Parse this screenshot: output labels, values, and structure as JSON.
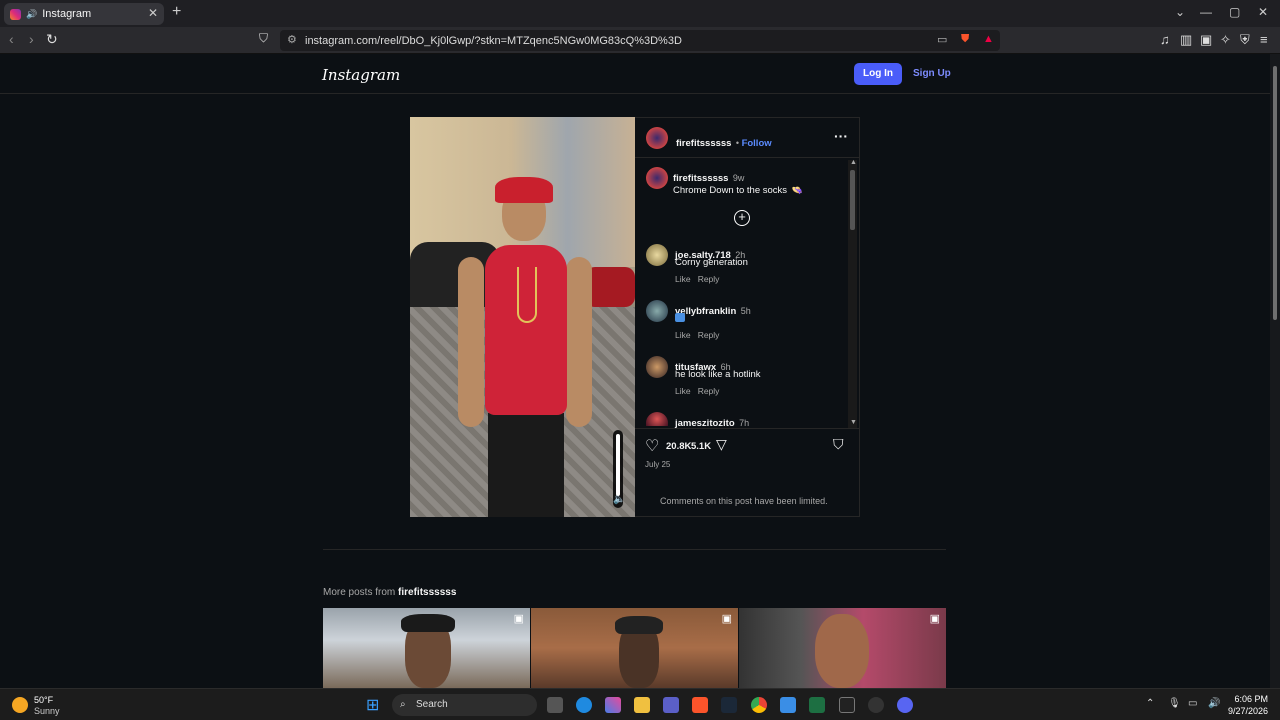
{
  "browser": {
    "tab_title": "Instagram",
    "url": "instagram.com/reel/DbO_Kj0lGwp/?stkn=MTZqenc5NGw0MG83cQ%3D%3D"
  },
  "header": {
    "logo": "Instagram",
    "login_label": "Log In",
    "signup_label": "Sign Up"
  },
  "post": {
    "username": "firefitssssss",
    "follow": "Follow",
    "caption_user": "firefitssssss",
    "caption_time": "9w",
    "caption": "Chrome Down to the socks",
    "likes": "20.8K",
    "comments_count": "5.1K",
    "date": "July 25",
    "limited_notice": "Comments on this post have been limited."
  },
  "comments": [
    {
      "user": "joe.salty.718",
      "time": "2h",
      "text": "Corny generation",
      "like": "Like",
      "reply": "Reply"
    },
    {
      "user": "vellybfranklin",
      "time": "5h",
      "text": "",
      "like": "Like",
      "reply": "Reply"
    },
    {
      "user": "titusfawx",
      "time": "6h",
      "text": "he look like a hotlink",
      "like": "Like",
      "reply": "Reply"
    },
    {
      "user": "jameszitozito",
      "time": "7h",
      "text": "",
      "like": "",
      "reply": ""
    }
  ],
  "more_posts": {
    "prefix": "More posts from",
    "user": "firefitssssss"
  },
  "taskbar": {
    "temp": "50°F",
    "weather": "Sunny",
    "search": "Search",
    "time": "6:06 PM",
    "date": "9/27/2026"
  }
}
